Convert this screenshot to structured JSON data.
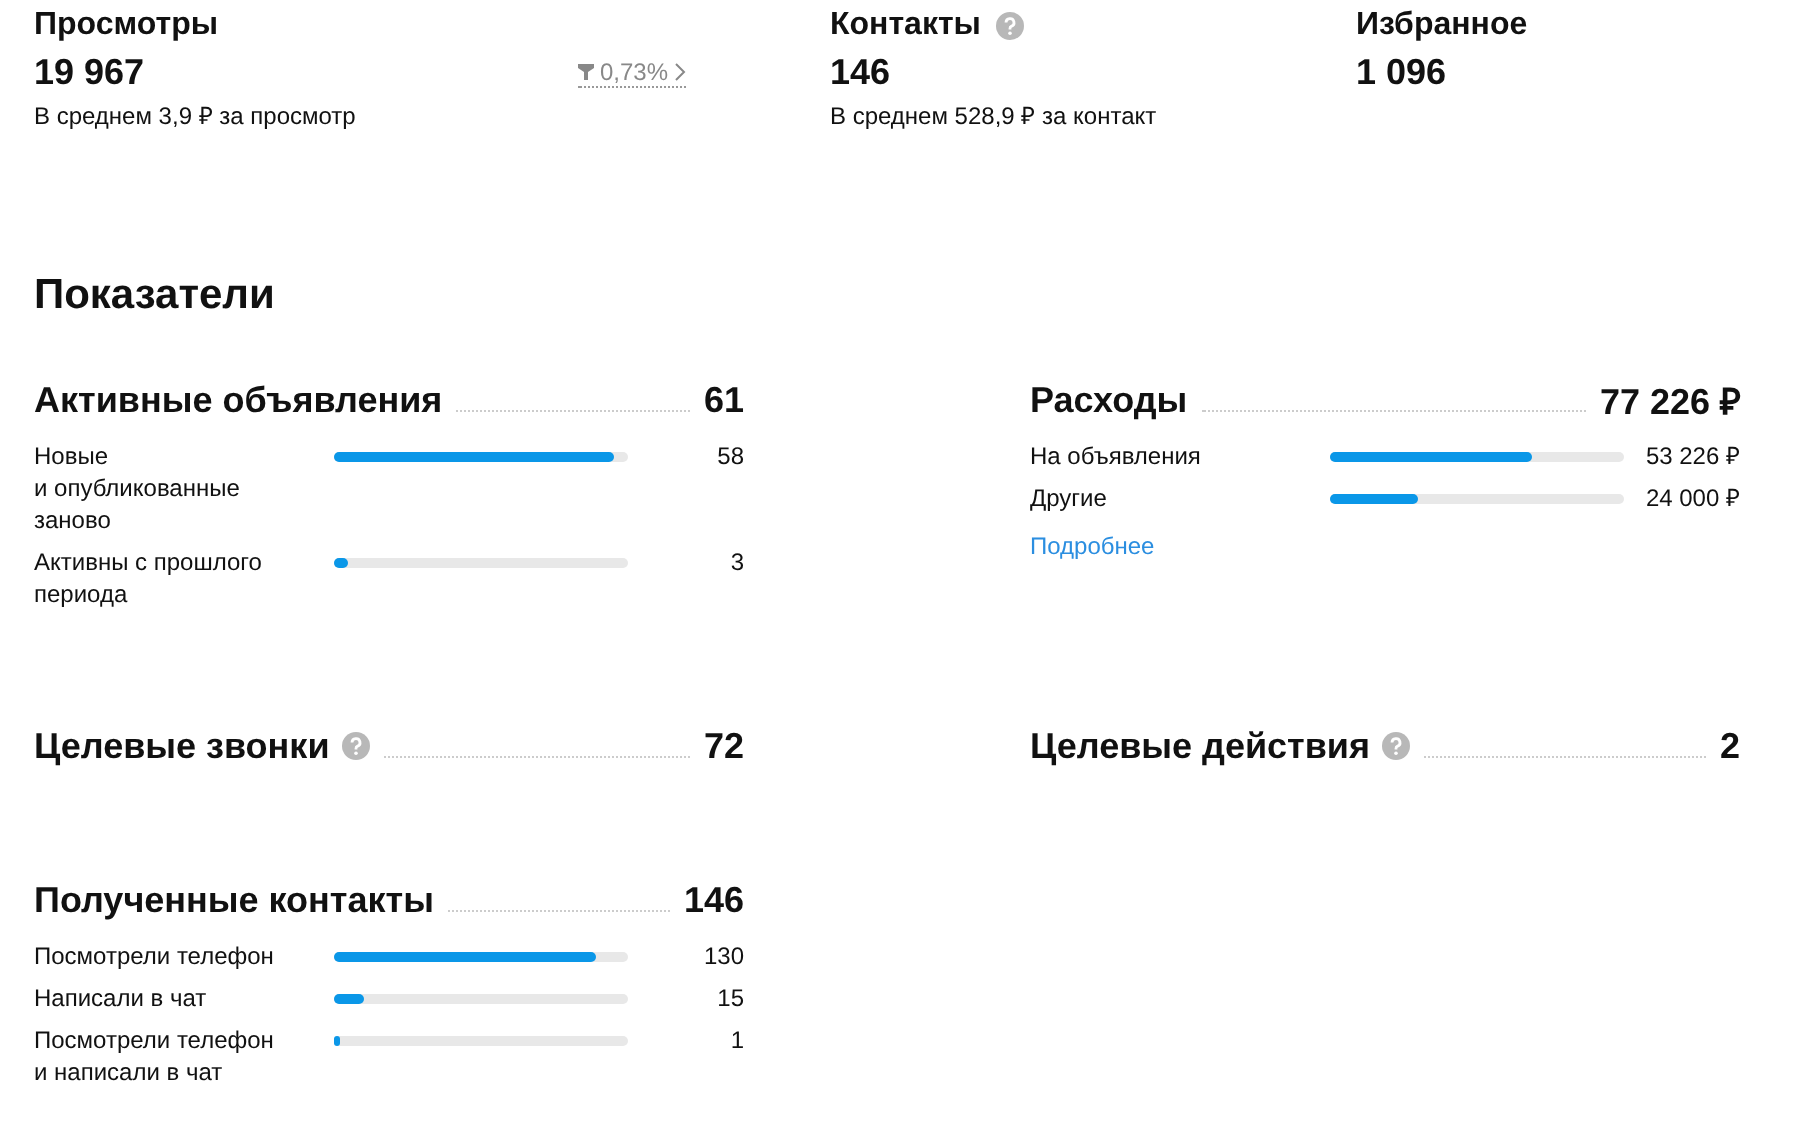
{
  "stats": [
    {
      "title": "Просмотры",
      "help": false,
      "value": "19 967",
      "note": "В среднем 3,9 ₽ за просмотр",
      "trend": {
        "text": "0,73%"
      }
    },
    {
      "title": "Контакты",
      "help": true,
      "value": "146",
      "note": "В среднем 528,9 ₽ за контакт"
    },
    {
      "title": "Избранное",
      "help": false,
      "value": "1 096"
    }
  ],
  "section_title": "Показатели",
  "metrics": [
    {
      "title": "Активные объявления",
      "help": false,
      "value": "61",
      "rows": [
        {
          "label": "Новые\nи опубликованные\nзаново",
          "level": 0.95,
          "value": "58"
        },
        {
          "label": "Активны с прошлого\nпериода",
          "level": 0.05,
          "value": "3"
        }
      ]
    },
    {
      "title": "Расходы",
      "help": false,
      "value": "77 226 ₽",
      "rows": [
        {
          "label": "На объявления",
          "level": 0.69,
          "value": "53 226 ₽"
        },
        {
          "label": "Другие",
          "level": 0.3,
          "value": "24 000 ₽"
        }
      ],
      "link": "Подробнее"
    },
    {
      "title": "Целевые звонки",
      "help": true,
      "value": "72"
    },
    {
      "title": "Целевые действия",
      "help": true,
      "value": "2"
    },
    {
      "title": "Полученные контакты",
      "help": false,
      "value": "146",
      "rows": [
        {
          "label": "Посмотрели телефон",
          "level": 0.89,
          "value": "130"
        },
        {
          "label": "Написали в чат",
          "level": 0.1,
          "value": "15"
        },
        {
          "label": "Посмотрели телефон\nи написали в чат",
          "level": 0.02,
          "value": "1"
        }
      ]
    }
  ]
}
